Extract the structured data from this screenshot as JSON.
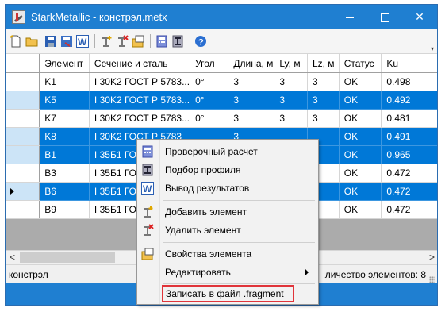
{
  "window": {
    "title": "StarkMetallic - констрэл.metx"
  },
  "toolbar": {
    "tools": [
      "new-file-icon",
      "open-folder-icon",
      "save-icon",
      "save-as-icon",
      "word-export-icon",
      "add-element-icon",
      "delete-element-icon",
      "element-properties-icon",
      "check-calc-icon",
      "profile-selection-icon",
      "help-icon"
    ]
  },
  "table": {
    "columns": [
      "Элемент",
      "Сечение и сталь",
      "Угол",
      "Длина, м",
      "Ly, м",
      "Lz, м",
      "Статус",
      "Ku"
    ],
    "rows": [
      {
        "cells": [
          "K1",
          "I 30K2 ГОСТ Р 5783...",
          "0°",
          "3",
          "3",
          "3",
          "OK",
          "0.498"
        ],
        "selected": false,
        "current": false
      },
      {
        "cells": [
          "K5",
          "I 30K2 ГОСТ Р 5783...",
          "0°",
          "3",
          "3",
          "3",
          "OK",
          "0.492"
        ],
        "selected": true,
        "current": false
      },
      {
        "cells": [
          "K7",
          "I 30K2 ГОСТ Р 5783...",
          "0°",
          "3",
          "3",
          "3",
          "OK",
          "0.481"
        ],
        "selected": false,
        "current": false
      },
      {
        "cells": [
          "K8",
          "I 30K2 ГОСТ Р 5783",
          "",
          "3",
          "",
          "",
          "OK",
          "0.491"
        ],
        "selected": true,
        "current": false
      },
      {
        "cells": [
          "B1",
          "I 35Б1 ГОСТ",
          "",
          "",
          "",
          "",
          "OK",
          "0.965"
        ],
        "selected": true,
        "current": false
      },
      {
        "cells": [
          "B3",
          "I 35Б1 ГОСТ",
          "",
          "",
          "",
          "",
          "OK",
          "0.472"
        ],
        "selected": false,
        "current": false
      },
      {
        "cells": [
          "B6",
          "I 35Б1 ГОСТ",
          "",
          "",
          "",
          "",
          "OK",
          "0.472"
        ],
        "selected": true,
        "current": true
      },
      {
        "cells": [
          "B9",
          "I 35Б1 ГОС",
          "",
          "",
          "",
          "",
          "OK",
          "0.472"
        ],
        "selected": false,
        "current": false
      }
    ]
  },
  "statusbar": {
    "left": "констрэл",
    "right": "личество элементов:  8"
  },
  "context_menu": {
    "items": [
      {
        "label": "Проверочный расчет",
        "icon": "check-calc-icon"
      },
      {
        "label": "Подбор профиля",
        "icon": "profile-selection-icon"
      },
      {
        "label": "Вывод результатов",
        "icon": "word-export-icon"
      },
      {
        "label": "Добавить элемент",
        "icon": "add-element-icon"
      },
      {
        "label": "Удалить элемент",
        "icon": "delete-element-icon"
      },
      {
        "label": "Свойства элемента",
        "icon": "element-properties-icon"
      },
      {
        "label": "Редактировать",
        "icon": ""
      },
      {
        "label": "Записать в файл .fragment",
        "icon": ""
      }
    ],
    "highlighted_index": 7,
    "highlight_color": "#e0343a"
  },
  "colors": {
    "titlebar": "#1f7fd1",
    "selection": "#0078d7",
    "grid_background": "#ababab"
  }
}
